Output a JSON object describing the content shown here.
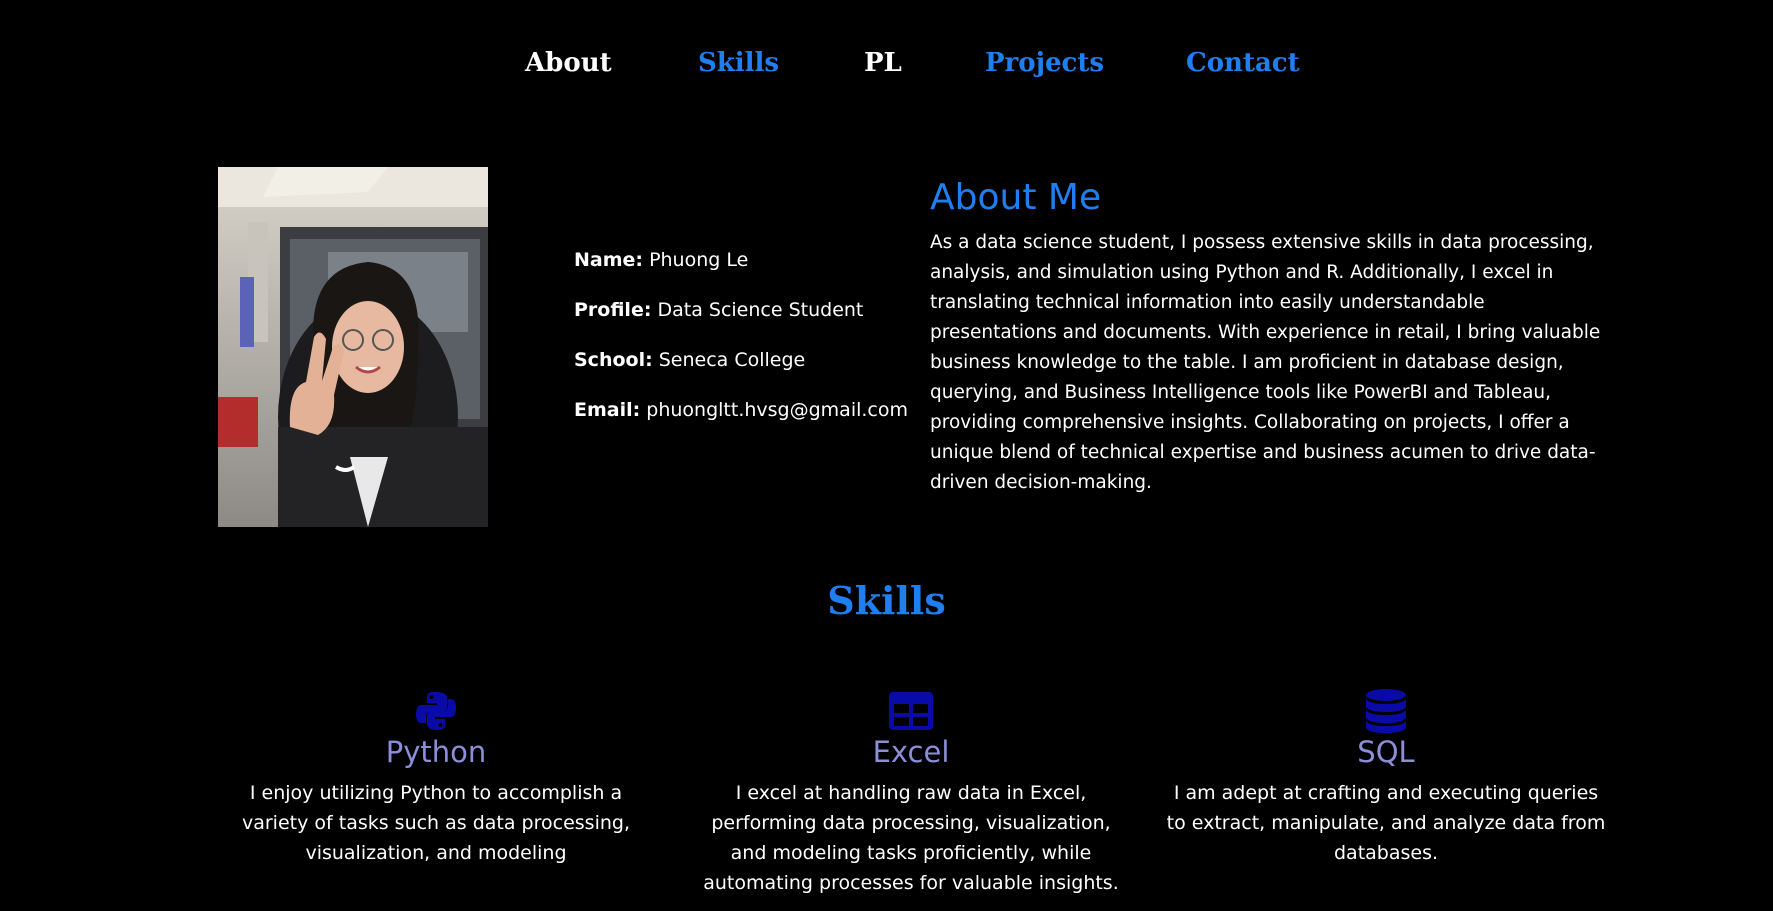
{
  "nav": {
    "about": "About",
    "skills": "Skills",
    "pl": "PL",
    "projects": "Projects",
    "contact": "Contact"
  },
  "profile": {
    "name_label": "Name:",
    "name_value": "Phuong Le",
    "profile_label": "Profile:",
    "profile_value": "Data Science Student",
    "school_label": "School:",
    "school_value": "Seneca College",
    "email_label": "Email:",
    "email_value": "phuongltt.hvsg@gmail.com"
  },
  "about": {
    "title": "About Me",
    "body": "As a data science student, I possess extensive skills in data processing, analysis, and simulation using Python and R. Additionally, I excel in translating technical information into easily understandable presentations and documents. With experience in retail, I bring valuable business knowledge to the table. I am proficient in database design, querying, and Business Intelligence tools like PowerBI and Tableau, providing comprehensive insights. Collaborating on projects, I offer a unique blend of technical expertise and business acumen to drive data-driven decision-making."
  },
  "skills": {
    "title": "Skills",
    "items": [
      {
        "icon": "python-icon",
        "name": "Python",
        "desc": "I enjoy utilizing Python to accomplish a variety of tasks such as data processing, visualization, and modeling"
      },
      {
        "icon": "table-icon",
        "name": "Excel",
        "desc": "I excel at handling raw data in Excel, performing data processing, visualization, and modeling tasks proficiently, while automating processes for valuable insights."
      },
      {
        "icon": "database-icon",
        "name": "SQL",
        "desc": "I am adept at crafting and executing queries to extract, manipulate, and analyze data from databases."
      }
    ]
  },
  "colors": {
    "accent": "#1f7ff0",
    "skill_name": "#8b8fd9",
    "icon": "#0a0aa8",
    "background": "#000000"
  }
}
